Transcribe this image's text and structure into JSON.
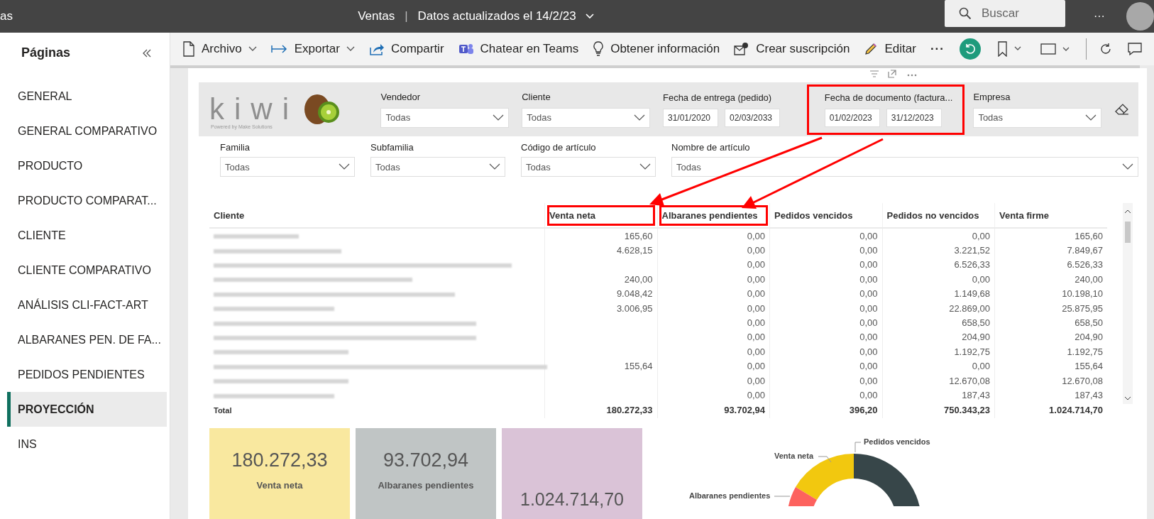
{
  "top_bar": {
    "app_fragment": "as",
    "report_title": "Ventas",
    "separator": "|",
    "updated": "Datos actualizados el 14/2/23",
    "search": {
      "placeholder": "Buscar"
    },
    "more": "···"
  },
  "sidebar": {
    "title": "Páginas",
    "items": [
      {
        "label": "GENERAL",
        "selected": false
      },
      {
        "label": "GENERAL COMPARATIVO",
        "selected": false
      },
      {
        "label": "PRODUCTO",
        "selected": false
      },
      {
        "label": "PRODUCTO COMPARAT...",
        "selected": false
      },
      {
        "label": "CLIENTE",
        "selected": false
      },
      {
        "label": "CLIENTE COMPARATIVO",
        "selected": false
      },
      {
        "label": "ANÁLISIS CLI-FACT-ART",
        "selected": false
      },
      {
        "label": "ALBARANES PEN. DE FA...",
        "selected": false
      },
      {
        "label": "PEDIDOS PENDIENTES",
        "selected": false
      },
      {
        "label": "PROYECCIÓN",
        "selected": true
      },
      {
        "label": "INS",
        "selected": false
      }
    ]
  },
  "toolbar": [
    {
      "kind": "file",
      "label": "Archivo",
      "dropdown": true
    },
    {
      "kind": "export",
      "label": "Exportar",
      "dropdown": true
    },
    {
      "kind": "share",
      "label": "Compartir",
      "dropdown": false
    },
    {
      "kind": "teams",
      "label": "Chatear en Teams",
      "dropdown": false
    },
    {
      "kind": "insight",
      "label": "Obtener información",
      "dropdown": false
    },
    {
      "kind": "subscribe",
      "label": "Crear suscripción",
      "dropdown": false
    },
    {
      "kind": "edit",
      "label": "Editar",
      "dropdown": false
    },
    {
      "kind": "more",
      "label": "···",
      "dropdown": false
    }
  ],
  "logo": {
    "word": "kiwi",
    "tagline": "Powered by Make Solutions"
  },
  "filters_top": [
    {
      "kind": "dropdown",
      "label": "Vendedor",
      "value": "Todas",
      "highlighted": false
    },
    {
      "kind": "dropdown",
      "label": "Cliente",
      "value": "Todas",
      "highlighted": false
    },
    {
      "kind": "date_range",
      "label": "Fecha de entrega (pedido)",
      "from": "31/01/2020",
      "to": "02/03/2033",
      "highlighted": false
    },
    {
      "kind": "date_range",
      "label": "Fecha de documento (factura...",
      "from": "01/02/2023",
      "to": "31/12/2023",
      "highlighted": true
    },
    {
      "kind": "dropdown",
      "label": "Empresa",
      "value": "Todas",
      "highlighted": false
    }
  ],
  "filters_bottom": [
    {
      "kind": "dropdown",
      "label": "Familia",
      "value": "Todas"
    },
    {
      "kind": "dropdown",
      "label": "Subfamilia",
      "value": "Todas"
    },
    {
      "kind": "dropdown",
      "label": "Código de artículo",
      "value": "Todas"
    },
    {
      "kind": "dropdown",
      "label": "Nombre de artículo",
      "value": "Todas"
    }
  ],
  "table": {
    "columns": [
      {
        "label": "Cliente",
        "highlighted": false
      },
      {
        "label": "Venta neta",
        "highlighted": true
      },
      {
        "label": "Albaranes pendientes",
        "highlighted": true
      },
      {
        "label": "Pedidos vencidos",
        "highlighted": false
      },
      {
        "label": "Pedidos no vencidos",
        "highlighted": false
      },
      {
        "label": "Venta firme",
        "highlighted": false
      }
    ],
    "rows": [
      [
        null,
        "165,60",
        "0,00",
        "0,00",
        "0,00",
        "165,60"
      ],
      [
        null,
        "4.628,15",
        "0,00",
        "0,00",
        "3.221,52",
        "7.849,67"
      ],
      [
        null,
        null,
        "0,00",
        "0,00",
        "6.526,33",
        "6.526,33"
      ],
      [
        null,
        "240,00",
        "0,00",
        "0,00",
        "0,00",
        "240,00"
      ],
      [
        null,
        "9.048,42",
        "0,00",
        "0,00",
        "1.149,68",
        "10.198,10"
      ],
      [
        null,
        "3.006,95",
        "0,00",
        "0,00",
        "22.869,00",
        "25.875,95"
      ],
      [
        null,
        null,
        "0,00",
        "0,00",
        "658,50",
        "658,50"
      ],
      [
        null,
        null,
        "0,00",
        "0,00",
        "204,90",
        "204,90"
      ],
      [
        null,
        null,
        "0,00",
        "0,00",
        "1.192,75",
        "1.192,75"
      ],
      [
        null,
        "155,64",
        "0,00",
        "0,00",
        "0,00",
        "155,64"
      ],
      [
        null,
        null,
        "0,00",
        "0,00",
        "12.670,08",
        "12.670,08"
      ],
      [
        null,
        null,
        "0,00",
        "0,00",
        "187,43",
        "187,43"
      ]
    ],
    "total": [
      "Total",
      "180.272,33",
      "93.702,94",
      "396,20",
      "750.343,23",
      "1.024.714,70"
    ]
  },
  "cards": [
    {
      "value": "180.272,33",
      "label": "Venta neta",
      "color": "#f9e89f"
    },
    {
      "value": "93.702,94",
      "label": "Albaranes pendientes",
      "color": "#c0c5c5"
    },
    {
      "value": "1.024.714,70",
      "color": "#dac3d7"
    }
  ],
  "donut_labels": [
    {
      "label": "Pedidos vencidos",
      "color": "#374649"
    },
    {
      "label": "Venta neta",
      "color": "#f2c80f"
    },
    {
      "label": "Albaranes pendientes",
      "color": "#fd625e"
    }
  ]
}
